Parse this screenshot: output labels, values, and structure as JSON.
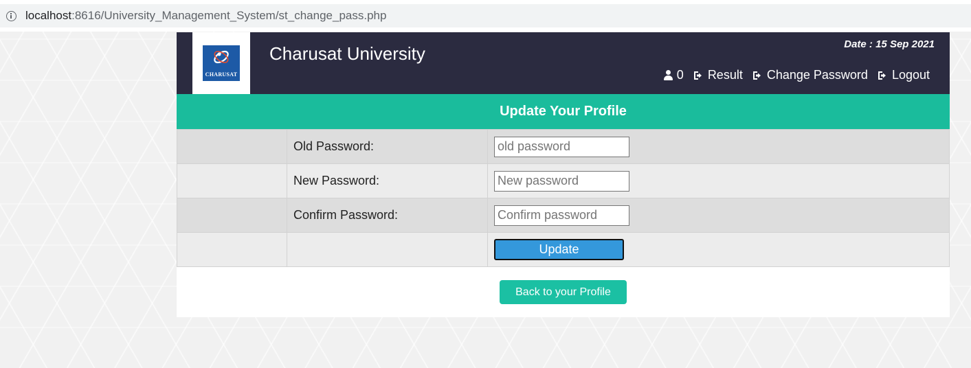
{
  "browser": {
    "url_host": "localhost",
    "url_path": ":8616/University_Management_System/st_change_pass.php"
  },
  "header": {
    "logo_text": "CHARUSAT",
    "title": "Charusat University",
    "date": "Date : 15 Sep 2021",
    "nav": {
      "user_count": "0",
      "result": "Result",
      "change_password": "Change Password",
      "logout": "Logout"
    }
  },
  "banner": {
    "title": "Update Your Profile"
  },
  "form": {
    "old_label": "Old Password:",
    "old_placeholder": "old password",
    "new_label": "New Password:",
    "new_placeholder": "New password",
    "confirm_label": "Confirm Password:",
    "confirm_placeholder": "Confirm password",
    "update_label": "Update"
  },
  "back_label": "Back to your Profile",
  "colors": {
    "header_bg": "#2b2b40",
    "banner_bg": "#1abc9c",
    "update_btn": "#3498db",
    "back_btn": "#1bc0a3"
  }
}
